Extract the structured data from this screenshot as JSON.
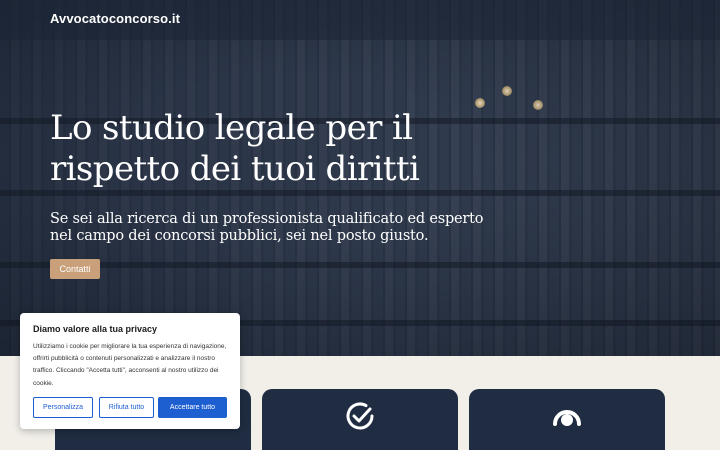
{
  "navbar": {
    "brand": "Avvocatoconcorso.it"
  },
  "hero": {
    "title": "Lo studio legale per il rispetto dei tuoi diritti",
    "subtitle": "Se sei alla ricerca di un professionista qualificato ed esperto nel campo dei concorsi pubblici, sei nel posto giusto.",
    "cta_label": "Contatti"
  },
  "cards": [
    {
      "icon": "scale-icon",
      "title": ""
    },
    {
      "icon": "check-circle-icon",
      "title": ""
    },
    {
      "icon": "support-icon",
      "title": ""
    }
  ],
  "cookie_banner": {
    "title": "Diamo valore alla tua privacy",
    "text": "Utilizziamo i cookie per migliorare la tua esperienza di navigazione, offrirti pubblicità o contenuti personalizzati e analizzare il nostro traffico. Cliccando \"Accetta tutti\", acconsenti al nostro utilizzo dei cookie.",
    "customize_label": "Personalizza",
    "reject_label": "Rifiuta tutto",
    "accept_label": "Accettare tutto"
  },
  "colors": {
    "accent": "#c9a07a",
    "card_bg": "#1f2c42",
    "cookie_primary": "#1d5fd0",
    "page_bg": "#f2efe9"
  }
}
